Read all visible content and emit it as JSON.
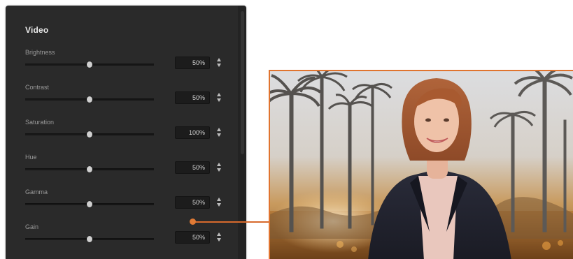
{
  "panel": {
    "title": "Video",
    "rows": [
      {
        "label": "Brightness",
        "value": "50%",
        "level": 0.5
      },
      {
        "label": "Contrast",
        "value": "50%",
        "level": 0.5
      },
      {
        "label": "Saturation",
        "value": "100%",
        "level": 0.5
      },
      {
        "label": "Hue",
        "value": "50%",
        "level": 0.5
      },
      {
        "label": "Gamma",
        "value": "50%",
        "level": 0.5
      },
      {
        "label": "Gain",
        "value": "50%",
        "level": 0.5
      }
    ]
  },
  "preview": {
    "description_icon": "video-preview-image"
  },
  "colors": {
    "panel_bg": "#2a2a2a",
    "accent": "#e0742f",
    "value_text": "#d2d2d2"
  }
}
